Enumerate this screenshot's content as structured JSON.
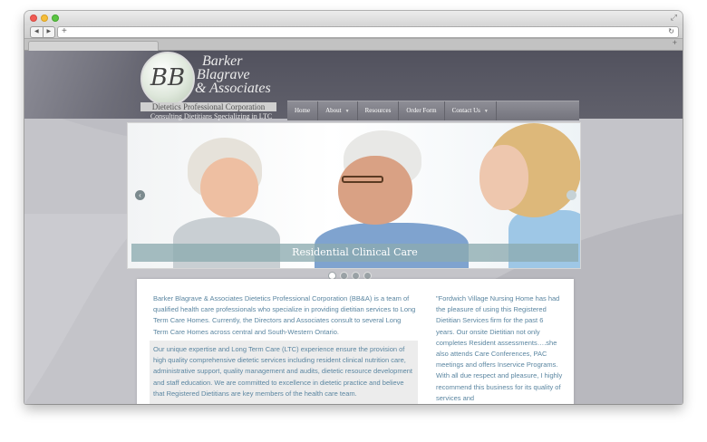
{
  "browser": {
    "back_glyph": "◀",
    "forward_glyph": "▶",
    "new_tab_glyph": "+",
    "reload_glyph": "↻",
    "add_glyph": "+",
    "resize_glyph": "⤢"
  },
  "site": {
    "logo": {
      "monogram": "BB",
      "name_line1": "Barker",
      "name_line2": "Blagrave",
      "name_line3": "& Associates",
      "subtitle": "Dietetics Professional Corporation",
      "tagline": "Consulting Dietitians Specializing in LTC"
    },
    "nav": {
      "items": [
        {
          "label": "Home",
          "has_dropdown": false
        },
        {
          "label": "About",
          "has_dropdown": true
        },
        {
          "label": "Resources",
          "has_dropdown": false
        },
        {
          "label": "Order Form",
          "has_dropdown": false
        },
        {
          "label": "Contact Us",
          "has_dropdown": true
        }
      ],
      "caret_glyph": "▼"
    },
    "slider": {
      "caption": "Residential Clinical Care",
      "prev_glyph": "‹",
      "slide_count": 4,
      "active_index": 0
    },
    "content": {
      "intro": "Barker Blagrave & Associates Dietetics Professional Corporation (BB&A) is a team of qualified health care professionals who specialize in providing dietitian services to Long Term Care Homes. Currently, the Directors and Associates consult to several Long Term Care Homes across central and South-Western Ontario.",
      "expertise": "Our unique expertise and Long Term Care (LTC) experience ensure the provision of high quality comprehensive dietetic services including resident clinical nutrition care, administrative support, quality management and audits, dietetic resource development and staff education. We are committed to excellence in dietetic practice and believe that Registered Dietitians are key members of the health care team.",
      "testimonial": "\"Fordwich Village Nursing Home has had the pleasure of using this Registered Dietitian Services firm for the past 6 years. Our onsite Dietitian not only completes Resident assessments….she also attends Care Conferences, PAC meetings and offers Inservice Programs. With all due respect and pleasure, I highly recommend this business for its quality of services and"
    }
  },
  "colors": {
    "header": "#5a5a66",
    "body_text": "#5b86a1",
    "caption_bar": "#8caaaf"
  }
}
